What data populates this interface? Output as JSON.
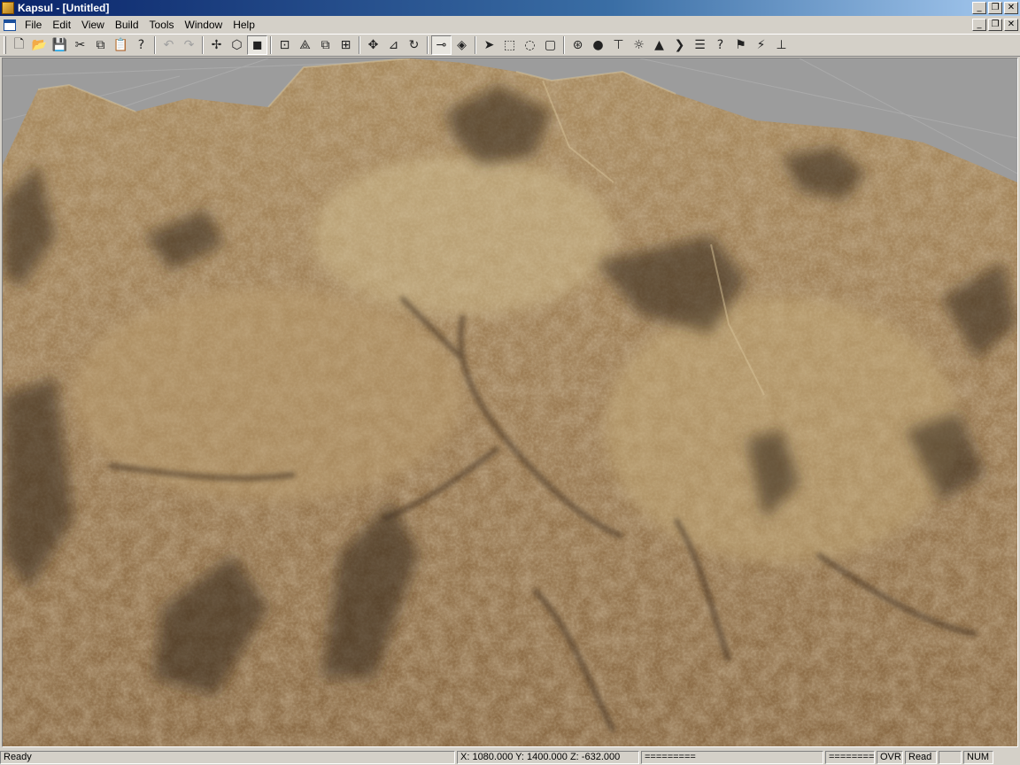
{
  "window": {
    "title": "Kapsul - [Untitled]"
  },
  "menu": [
    "File",
    "Edit",
    "View",
    "Build",
    "Tools",
    "Window",
    "Help"
  ],
  "window_buttons": {
    "minimize": "_",
    "restore": "❐",
    "close": "✕"
  },
  "toolbar": {
    "groups": [
      [
        {
          "icon": "new-file-icon",
          "glyph": "🗋"
        },
        {
          "icon": "open-folder-icon",
          "glyph": "📂"
        },
        {
          "icon": "save-icon",
          "glyph": "💾"
        },
        {
          "icon": "cut-icon",
          "glyph": "✂"
        },
        {
          "icon": "copy-icon",
          "glyph": "⧉"
        },
        {
          "icon": "paste-icon",
          "glyph": "📋"
        },
        {
          "icon": "help-context-icon",
          "glyph": "?"
        }
      ],
      [
        {
          "icon": "undo-icon",
          "glyph": "↶",
          "disabled": true
        },
        {
          "icon": "redo-icon",
          "glyph": "↷",
          "disabled": true
        }
      ],
      [
        {
          "icon": "snap-vertex-icon",
          "glyph": "✢"
        },
        {
          "icon": "wireframe-cube-icon",
          "glyph": "⬡"
        },
        {
          "icon": "solid-cube-icon",
          "glyph": "◼",
          "pressed": true
        }
      ],
      [
        {
          "icon": "zoom-extents-icon",
          "glyph": "⊡"
        },
        {
          "icon": "axis-icon",
          "glyph": "⟁"
        },
        {
          "icon": "duplicate-icon",
          "glyph": "⧉"
        },
        {
          "icon": "group-icon",
          "glyph": "⊞"
        }
      ],
      [
        {
          "icon": "move-icon",
          "glyph": "✥"
        },
        {
          "icon": "scale-icon",
          "glyph": "⊿"
        },
        {
          "icon": "rotate-icon",
          "glyph": "↻"
        }
      ],
      [
        {
          "icon": "camera-track-icon",
          "glyph": "⊸",
          "pressed": true
        },
        {
          "icon": "camera-orbit-icon",
          "glyph": "◈"
        }
      ],
      [
        {
          "icon": "select-arrow-icon",
          "glyph": "➤"
        },
        {
          "icon": "select-box-icon",
          "glyph": "⬚"
        },
        {
          "icon": "select-circle-icon",
          "glyph": "◌"
        },
        {
          "icon": "select-region-icon",
          "glyph": "▢"
        }
      ],
      [
        {
          "icon": "render-camera-icon",
          "glyph": "⊛"
        },
        {
          "icon": "sphere-icon",
          "glyph": "●"
        },
        {
          "icon": "terrain-tool-icon",
          "glyph": "⊤"
        },
        {
          "icon": "light-icon",
          "glyph": "☼"
        },
        {
          "icon": "mountain-icon",
          "glyph": "▲"
        },
        {
          "icon": "script-icon",
          "glyph": "❯"
        },
        {
          "icon": "notes-icon",
          "glyph": "☰"
        },
        {
          "icon": "help-icon",
          "glyph": "?"
        },
        {
          "icon": "flag-icon",
          "glyph": "⚑"
        },
        {
          "icon": "wand-icon",
          "glyph": "⚡"
        },
        {
          "icon": "measure-icon",
          "glyph": "⊥"
        }
      ]
    ]
  },
  "status": {
    "message": "Ready",
    "coords": "X: 1080.000 Y: 1400.000 Z: -632.000",
    "bar1": "=========",
    "bar2": "========",
    "ovr": "OVR",
    "read": "Read",
    "blank": "",
    "num": "NUM"
  },
  "viewport": {
    "background_color": "#9a9a9a",
    "terrain_colors": [
      "#8a6a45",
      "#a88a5a",
      "#c2a878",
      "#6b4a30",
      "#3f2e1e"
    ]
  }
}
